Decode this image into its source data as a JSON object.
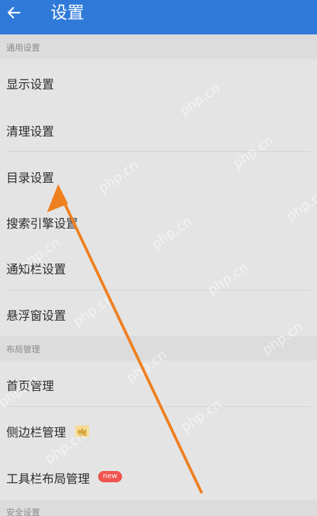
{
  "header": {
    "title": "设置",
    "back_icon": "arrow-left-icon",
    "color": "#2f7ad9"
  },
  "sections": {
    "general": {
      "title": "通用设置",
      "items": [
        "显示设置",
        "清理设置",
        "目录设置",
        "搜索引擎设置",
        "通知栏设置",
        "悬浮窗设置"
      ]
    },
    "layout": {
      "title": "布局管理",
      "items": [
        "首页管理",
        "侧边栏管理",
        "工具栏布局管理"
      ],
      "badge": "new",
      "crown_icon": "crown-icon"
    },
    "security": {
      "title": "安全设置"
    }
  },
  "annotation": {
    "arrow_color": "#ee7f1f"
  },
  "watermark": "php.cn"
}
